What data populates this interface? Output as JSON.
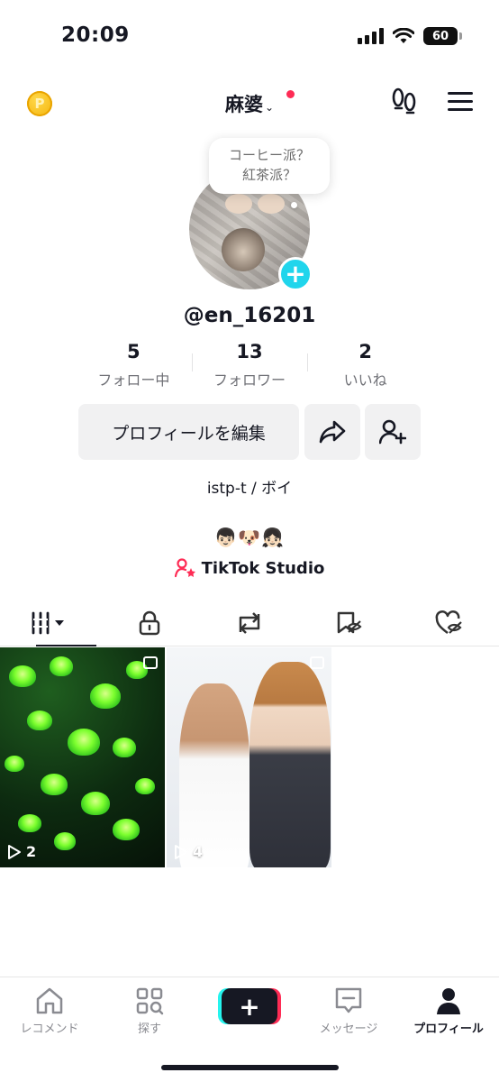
{
  "status_bar": {
    "time": "20:09",
    "battery": "60"
  },
  "header": {
    "coin_letter": "P",
    "username": "麻婆",
    "dropdown_chevron": "⌄"
  },
  "bubble": {
    "line1": "コーヒー派？",
    "line2": "紅茶派？"
  },
  "profile": {
    "handle": "@en_16201",
    "bio": "istp-t / ボイ",
    "emojis": "👦🏻🐶👧🏻",
    "studio_label": "TikTok Studio"
  },
  "stats": [
    {
      "value": "5",
      "label": "フォロー中"
    },
    {
      "value": "13",
      "label": "フォロワー"
    },
    {
      "value": "2",
      "label": "いいね"
    }
  ],
  "buttons": {
    "edit_label": "プロフィールを編集"
  },
  "tabs": [
    "videos-grid-icon",
    "lock-icon",
    "repost-icon",
    "favorites-icon",
    "liked-icon"
  ],
  "videos": [
    {
      "views": "2"
    },
    {
      "views": "4"
    }
  ],
  "bottom_nav": [
    {
      "label": "レコメンド"
    },
    {
      "label": "探す"
    },
    {
      "label": "メッセージ"
    },
    {
      "label": "プロフィール"
    }
  ],
  "colors": {
    "accent_red": "#fe2c55",
    "accent_cyan": "#20d5ec",
    "text": "#161823"
  }
}
